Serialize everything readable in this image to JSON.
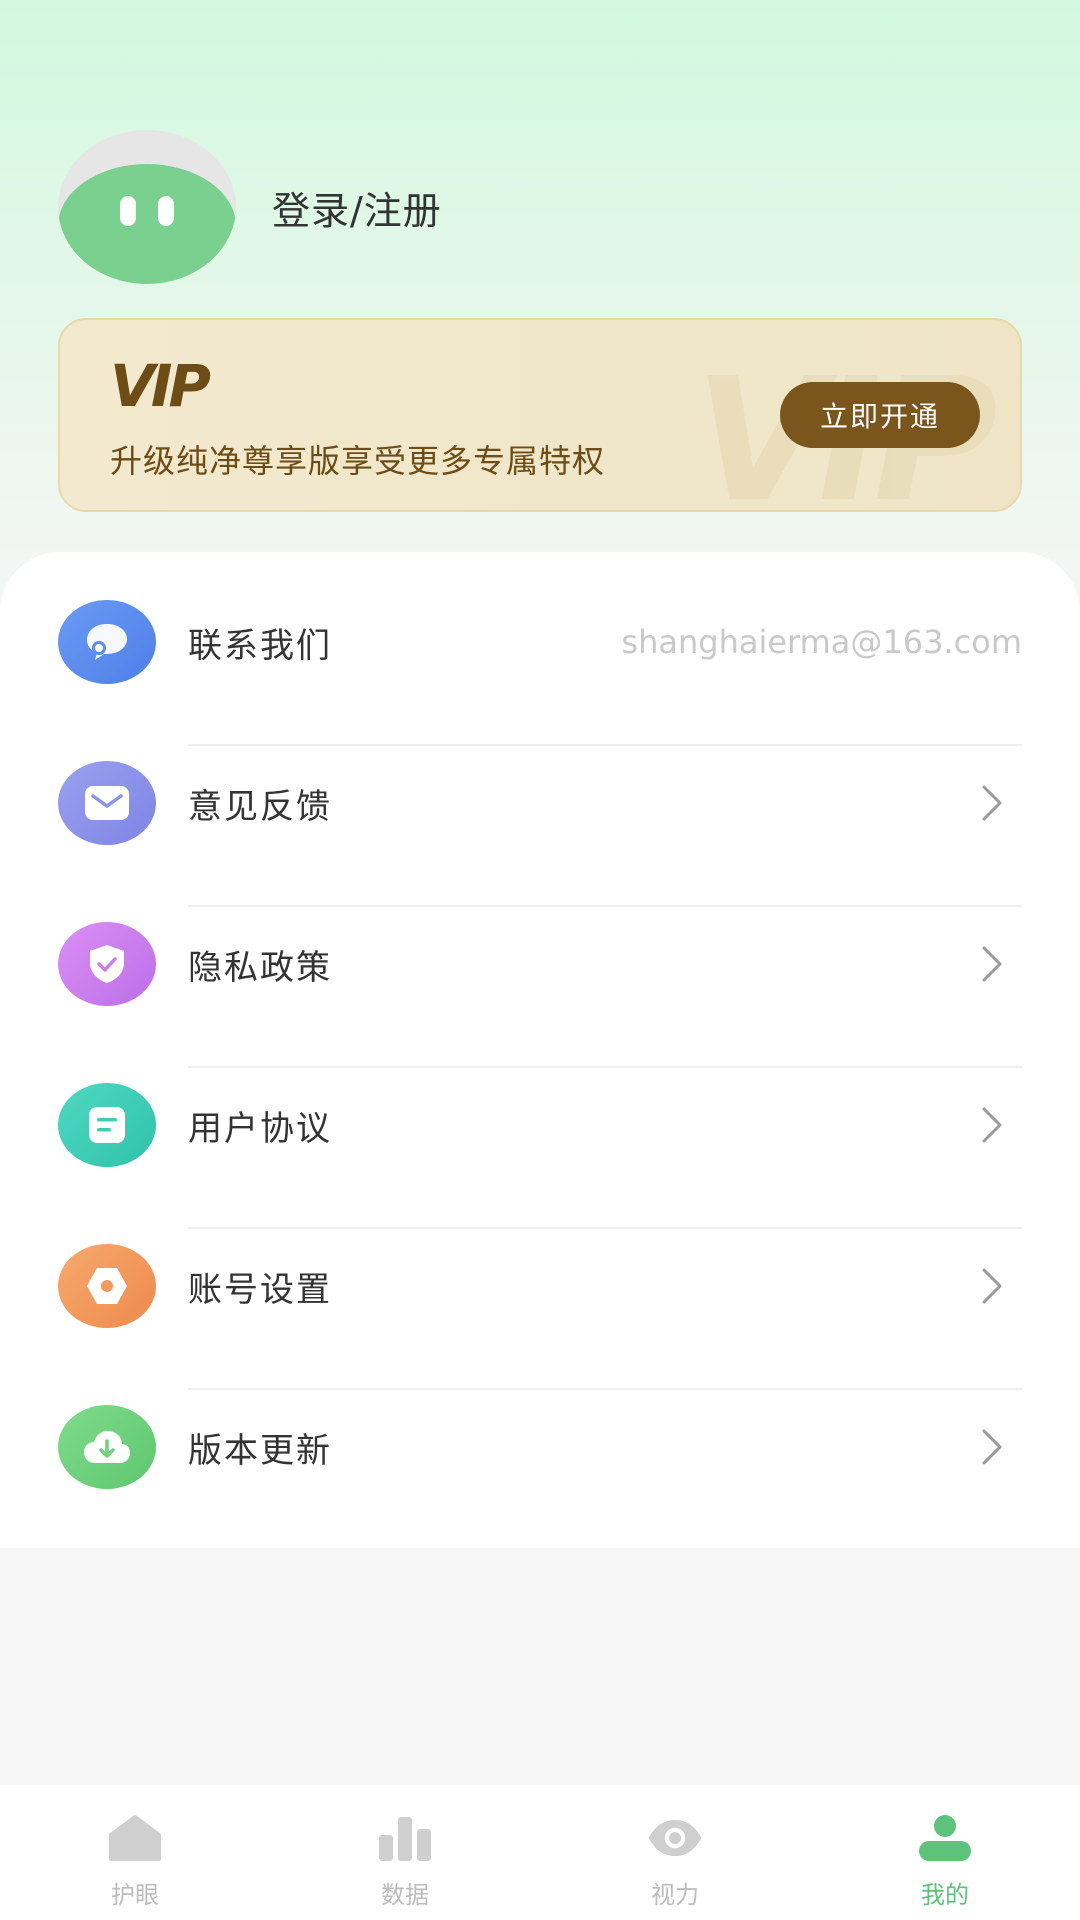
{
  "profile": {
    "login_label": "登录/注册"
  },
  "vip": {
    "logo_text": "VIP",
    "watermark_text": "VIP",
    "description": "升级纯净尊享版享受更多专属特权",
    "button_label": "立即开通"
  },
  "menu": {
    "items": [
      {
        "label": "联系我们",
        "value": "shanghaierma@163.com",
        "icon": "chat-bubble-icon",
        "color": "#5b8ef0"
      },
      {
        "label": "意见反馈",
        "icon": "envelope-icon",
        "color": "#8d93ea"
      },
      {
        "label": "隐私政策",
        "icon": "shield-check-icon",
        "color": "#cc7ef0"
      },
      {
        "label": "用户协议",
        "icon": "document-icon",
        "color": "#3fcdb7"
      },
      {
        "label": "账号设置",
        "icon": "gear-icon",
        "color": "#f39a5f"
      },
      {
        "label": "版本更新",
        "icon": "cloud-download-icon",
        "color": "#6fd07e"
      }
    ]
  },
  "tabbar": {
    "tabs": [
      {
        "label": "护眼",
        "icon": "home-icon"
      },
      {
        "label": "数据",
        "icon": "bar-chart-icon"
      },
      {
        "label": "视力",
        "icon": "eye-icon"
      },
      {
        "label": "我的",
        "icon": "user-icon",
        "active": true
      }
    ]
  },
  "colors": {
    "accent": "#5cc47a",
    "vip_brown": "#7a561d"
  }
}
